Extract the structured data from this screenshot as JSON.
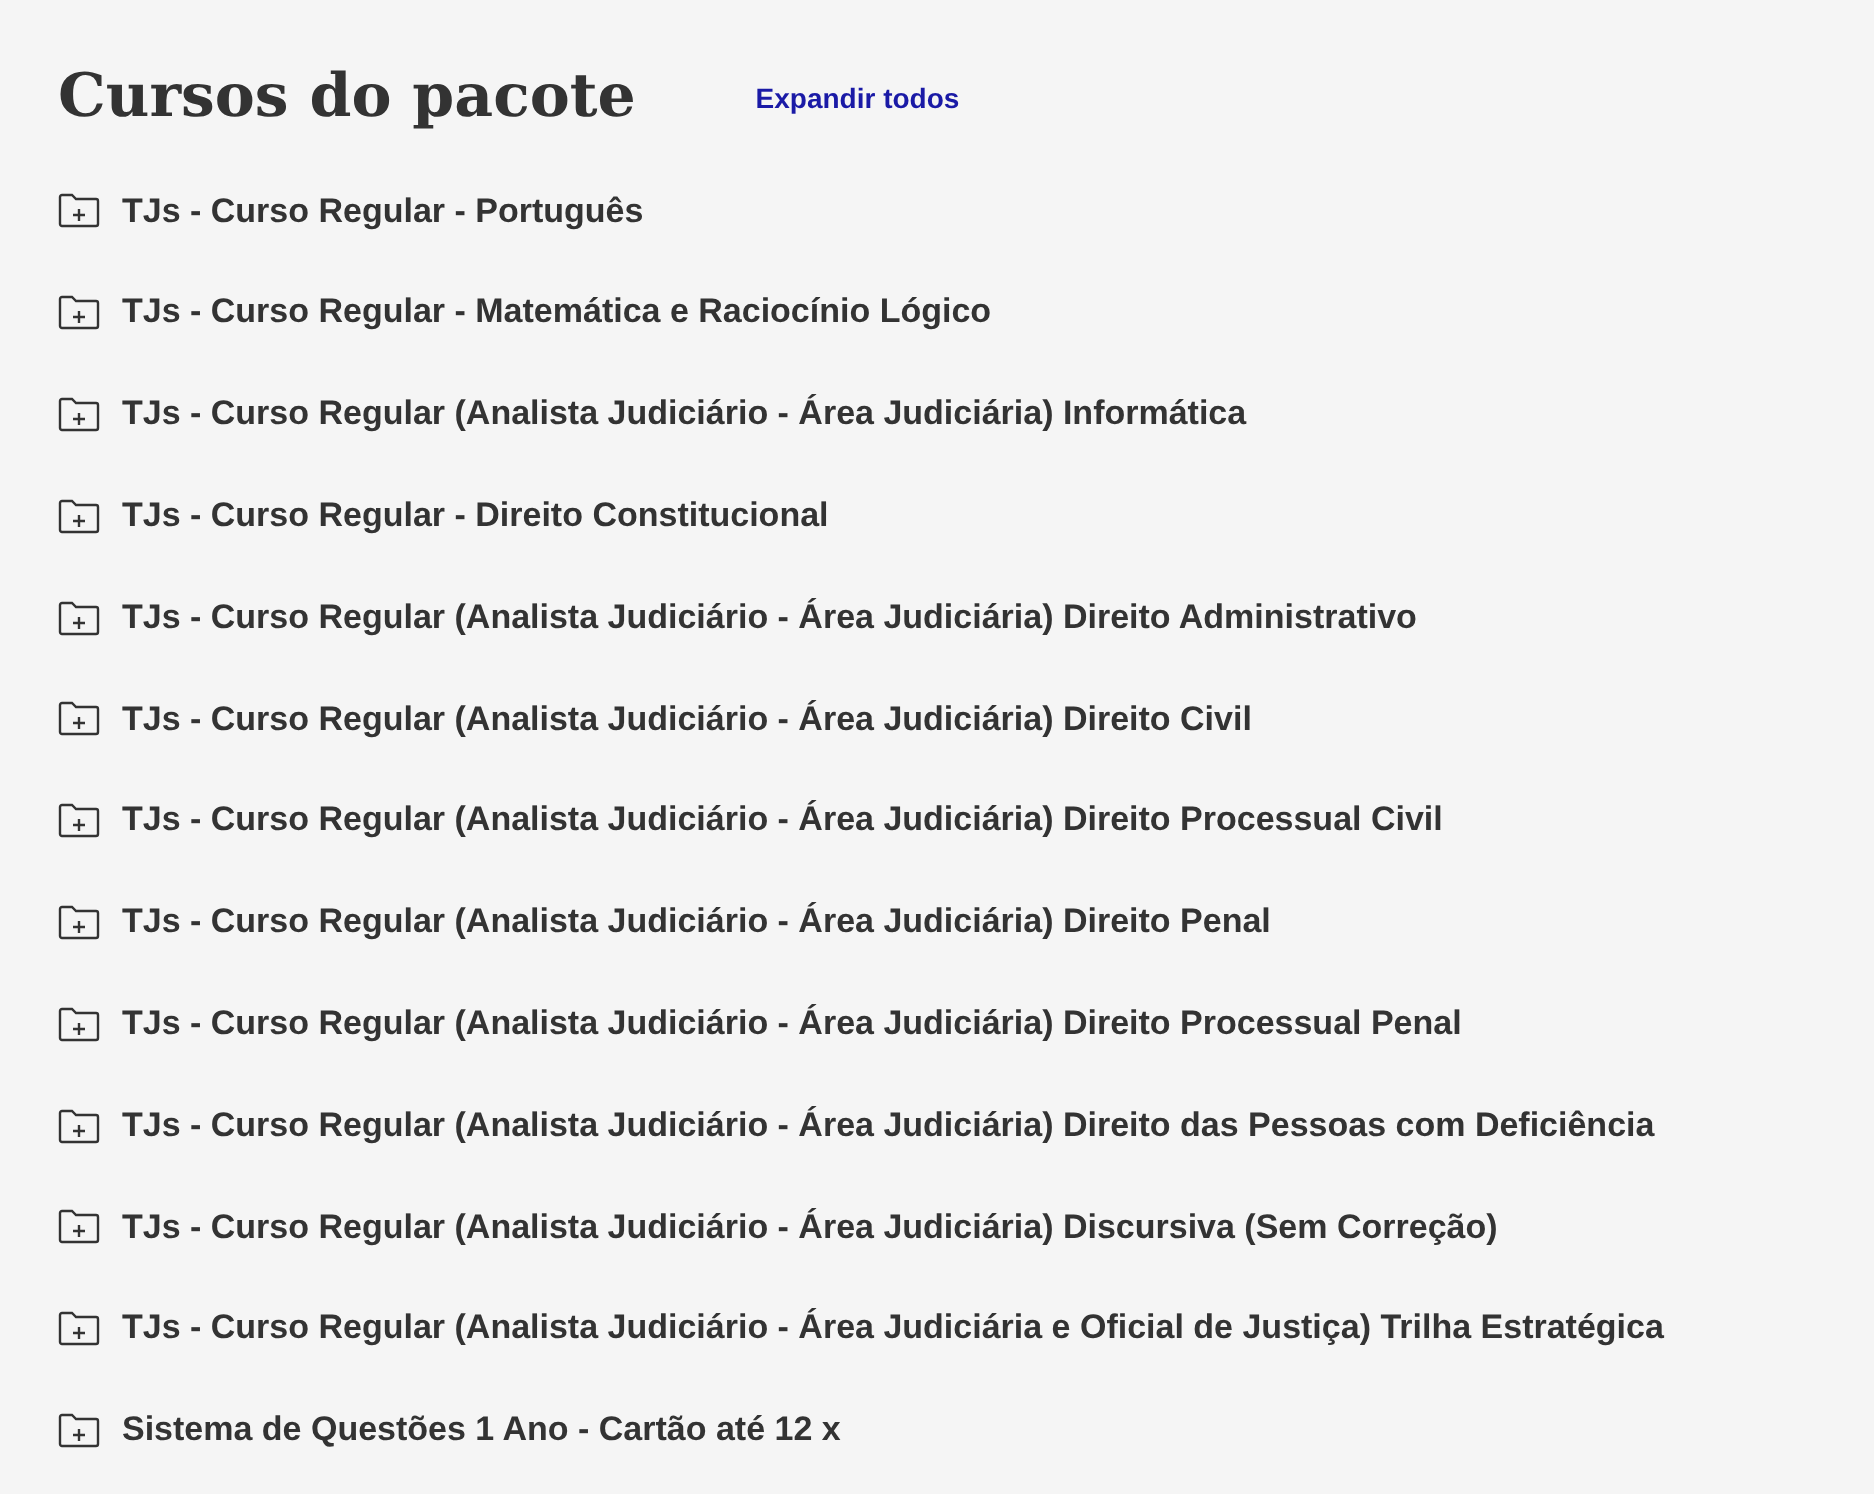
{
  "heading": "Cursos do pacote",
  "expand_all_link": "Expandir todos",
  "courses": [
    {
      "title": "TJs - Curso Regular - Português",
      "expanded": false
    },
    {
      "title": "TJs - Curso Regular - Matemática e Raciocínio Lógico",
      "expanded": false
    },
    {
      "title": "TJs - Curso Regular (Analista Judiciário - Área Judiciária) Informática",
      "expanded": false
    },
    {
      "title": "TJs - Curso Regular - Direito Constitucional",
      "expanded": false
    },
    {
      "title": "TJs - Curso Regular (Analista Judiciário - Área Judiciária) Direito Administrativo",
      "expanded": false
    },
    {
      "title": "TJs - Curso Regular (Analista Judiciário - Área Judiciária) Direito Civil",
      "expanded": false
    },
    {
      "title": "TJs - Curso Regular (Analista Judiciário - Área Judiciária) Direito Processual Civil",
      "expanded": false
    },
    {
      "title": "TJs - Curso Regular (Analista Judiciário - Área Judiciária) Direito Penal",
      "expanded": false
    },
    {
      "title": "TJs - Curso Regular (Analista Judiciário - Área Judiciária) Direito Processual Penal",
      "expanded": false
    },
    {
      "title": "TJs - Curso Regular (Analista Judiciário - Área Judiciária) Direito das Pessoas com Deficiência",
      "expanded": false
    },
    {
      "title": "TJs - Curso Regular (Analista Judiciário - Área Judiciária) Discursiva (Sem Correção)",
      "expanded": false
    },
    {
      "title": "TJs - Curso Regular (Analista Judiciário - Área Judiciária e Oficial de Justiça) Trilha Estratégica",
      "expanded": false
    },
    {
      "title": "Sistema de Questões 1 Ano - Cartão até 12 x",
      "expanded": false
    }
  ]
}
